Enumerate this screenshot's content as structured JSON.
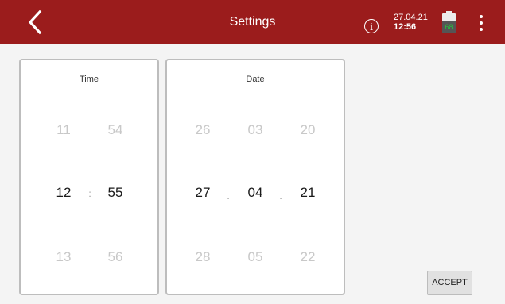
{
  "header": {
    "title": "Settings",
    "info_glyph": "i",
    "date": "27.04.21",
    "time": "12:56",
    "battery_level": "68",
    "back_icon": "chevron-left-icon",
    "menu_icon": "more-vertical-icon",
    "colors": {
      "bar": "#9b1c1c",
      "battery_text": "#27c23e"
    }
  },
  "time_panel": {
    "title": "Time",
    "separator": ":",
    "hours": {
      "prev": "11",
      "selected": "12",
      "next": "13"
    },
    "minutes": {
      "prev": "54",
      "selected": "55",
      "next": "56"
    }
  },
  "date_panel": {
    "title": "Date",
    "separator": ".",
    "day": {
      "prev": "26",
      "selected": "27",
      "next": "28"
    },
    "month": {
      "prev": "03",
      "selected": "04",
      "next": "05"
    },
    "year": {
      "prev": "20",
      "selected": "21",
      "next": "22"
    }
  },
  "accept_label": "ACCEPT"
}
